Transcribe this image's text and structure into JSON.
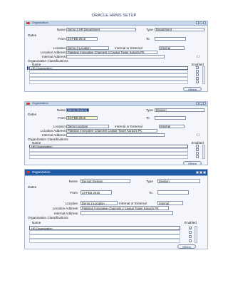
{
  "doc_title": "ORACLE HRMS SETUP",
  "labels": {
    "name": "Name",
    "type": "Type",
    "dates": "Dates",
    "from": "From",
    "to": "To",
    "location": "Location",
    "internal_or_external": "Internal or External",
    "location_address": "Location Address",
    "internal_address": "Internal Address",
    "org_classifications": "Organization Classifications",
    "col_name": "Name",
    "col_enabled": "Enabled",
    "others": "Others",
    "ia_btn": "[ ]"
  },
  "screens": [
    {
      "window_title": "Organization",
      "name": "Demo 3 HR Department",
      "type": "Department",
      "from": "23-FEB-2015",
      "to": "",
      "location": "Demo 3 Location",
      "internal_or_external": "Internal",
      "location_address": "Pakistan Innovative Channels 3 Ceasar Tower Karachi PK",
      "internal_address": "",
      "classification_rows": [
        "HR Organization",
        "",
        "",
        "",
        ""
      ],
      "enabled": [
        true,
        false,
        false,
        false,
        false
      ]
    },
    {
      "window_title": "Organization",
      "name": "Demo Division",
      "type": "Division",
      "from": "23-FEB-2015",
      "to": "",
      "location": "Demo Location",
      "internal_or_external": "Internal",
      "location_address": "Pakistan Innovative Channels Ceasar Tower Karachi PK",
      "internal_address": "",
      "classification_rows": [
        "HR Organization",
        "",
        "",
        ""
      ],
      "enabled": [
        true,
        false,
        false,
        false
      ]
    },
    {
      "window_title": "Organization",
      "name": "Demo2 Division",
      "type": "Division",
      "from": "23-FEB-2015",
      "to": "",
      "location": "Demo 2 Location",
      "internal_or_external": "Internal",
      "location_address": "Pakistan Innovative Channels 2 Ceasar Tower Karachi PK",
      "internal_address": "",
      "classification_rows": [
        "HR Organization",
        "",
        "",
        ""
      ],
      "enabled": [
        true,
        false,
        false,
        false
      ]
    }
  ],
  "colors": {
    "titlebar": "#c8d7ea",
    "active_titlebar": "#1f5aa6",
    "highlight_field": "#fffbc6",
    "selected_field": "#1a3d8a"
  }
}
